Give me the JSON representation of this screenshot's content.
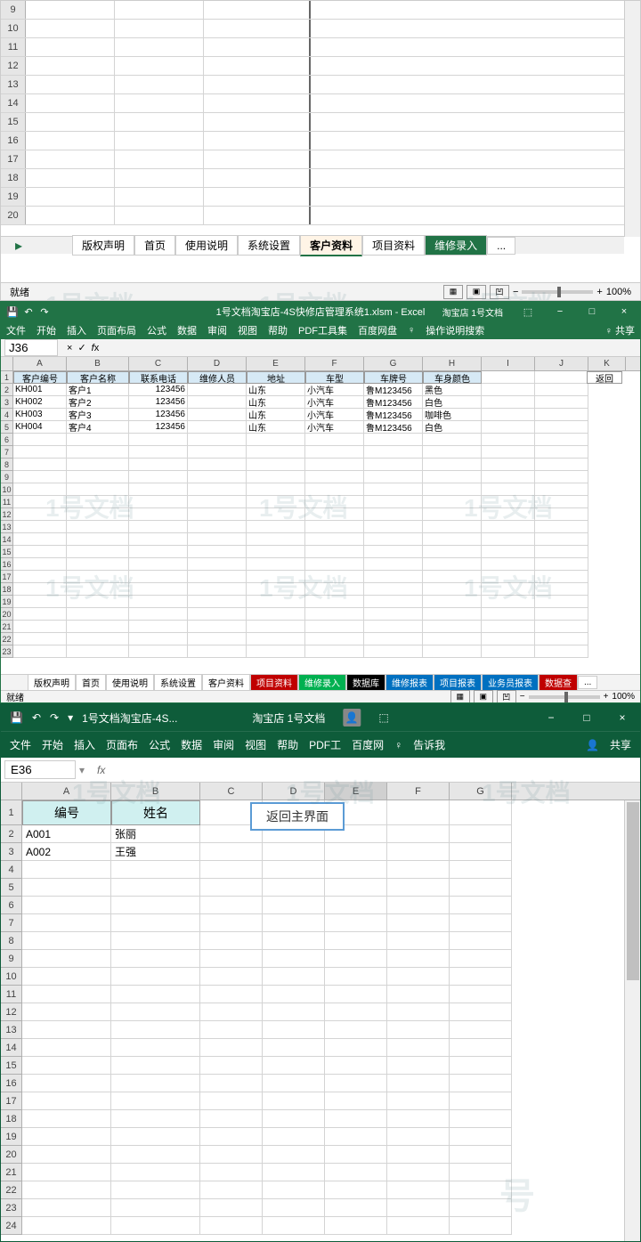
{
  "section1": {
    "rows": [
      9,
      10,
      11,
      12,
      13,
      14,
      15,
      16,
      17,
      18,
      19,
      20
    ],
    "tabs": {
      "copyright": "版权声明",
      "home": "首页",
      "usage": "使用说明",
      "settings": "系统设置",
      "customer": "客户资料",
      "project": "项目资料",
      "repair": "维修录入",
      "more": "..."
    },
    "status": "就绪",
    "zoom": "100%"
  },
  "section2": {
    "title": "1号文档淘宝店-4S快修店管理系统1.xlsm - Excel",
    "title_right": "淘宝店 1号文档",
    "ribbon": {
      "file": "文件",
      "home": "开始",
      "insert": "插入",
      "layout": "页面布局",
      "formula": "公式",
      "data": "数据",
      "review": "审阅",
      "view": "视图",
      "help": "帮助",
      "pdf": "PDF工具集",
      "baidu": "百度网盘",
      "tell": "操作说明搜索",
      "share": "共享"
    },
    "namebox": "J36",
    "cols": [
      "A",
      "B",
      "C",
      "D",
      "E",
      "F",
      "G",
      "H",
      "I",
      "J",
      "K"
    ],
    "headers": {
      "a": "客户编号",
      "b": "客户名称",
      "c": "联系电话",
      "d": "维修人员",
      "e": "地址",
      "f": "车型",
      "g": "车牌号",
      "h": "车身颜色"
    },
    "return_btn": "返回",
    "data_rows": [
      {
        "n": 2,
        "a": "KH001",
        "b": "客户1",
        "c": "123456",
        "d": "",
        "e": "山东",
        "f": "小汽车",
        "g": "鲁M123456",
        "h": "黑色"
      },
      {
        "n": 3,
        "a": "KH002",
        "b": "客户2",
        "c": "123456",
        "d": "",
        "e": "山东",
        "f": "小汽车",
        "g": "鲁M123456",
        "h": "白色"
      },
      {
        "n": 4,
        "a": "KH003",
        "b": "客户3",
        "c": "123456",
        "d": "",
        "e": "山东",
        "f": "小汽车",
        "g": "鲁M123456",
        "h": "咖啡色"
      },
      {
        "n": 5,
        "a": "KH004",
        "b": "客户4",
        "c": "123456",
        "d": "",
        "e": "山东",
        "f": "小汽车",
        "g": "鲁M123456",
        "h": "白色"
      }
    ],
    "empty_rows": [
      6,
      7,
      8,
      9,
      10,
      11,
      12,
      13,
      14,
      15,
      16,
      17,
      18,
      19,
      20,
      21,
      22,
      23
    ],
    "tabs": {
      "copyright": "版权声明",
      "home": "首页",
      "usage": "使用说明",
      "settings": "系统设置",
      "customer": "客户资料",
      "project": "项目资料",
      "repair": "维修录入",
      "db": "数据库",
      "repair_report": "维修报表",
      "project_report": "项目报表",
      "sales_report": "业务员报表",
      "data_query": "数据查",
      "more": "..."
    },
    "status": "就绪",
    "zoom": "100%"
  },
  "section3": {
    "title": "1号文档淘宝店-4S...",
    "title_center": "淘宝店 1号文档",
    "ribbon": {
      "file": "文件",
      "home": "开始",
      "insert": "插入",
      "layout": "页面布",
      "formula": "公式",
      "data": "数据",
      "review": "审阅",
      "view": "视图",
      "help": "帮助",
      "pdf": "PDF工",
      "baidu": "百度网",
      "tell": "告诉我",
      "share": "共享"
    },
    "namebox": "E36",
    "cols": [
      "A",
      "B",
      "C",
      "D",
      "E",
      "F",
      "G"
    ],
    "headers": {
      "a": "编号",
      "b": "姓名"
    },
    "return_btn": "返回主界面",
    "data_rows": [
      {
        "n": 2,
        "a": "A001",
        "b": "张丽"
      },
      {
        "n": 3,
        "a": "A002",
        "b": "王强"
      }
    ],
    "empty_rows": [
      4,
      5,
      6,
      7,
      8,
      9,
      10,
      11,
      12,
      13,
      14,
      15,
      16,
      17,
      18,
      19,
      20,
      21,
      22,
      23,
      24
    ]
  },
  "watermark": "1号文档"
}
